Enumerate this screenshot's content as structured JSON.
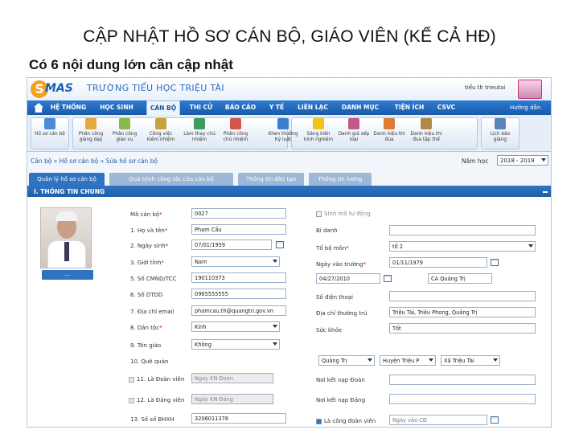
{
  "slide": {
    "title": "CẬP NHẬT HỒ SƠ CÁN BỘ, GIÁO VIÊN (KỂ CẢ HĐ)",
    "subtitle": "Có 6 nội dung lớn cần cập nhật"
  },
  "header": {
    "logo_letter": "S",
    "logo_text": "MAS",
    "school_name": "TRƯỜNG TIỂU HỌC TRIỆU TÀI",
    "user": "tiểu th trieutai"
  },
  "nav": {
    "items": [
      {
        "label": "HỆ THỐNG"
      },
      {
        "label": "HỌC SINH"
      },
      {
        "label": "CÁN BỘ"
      },
      {
        "label": "THI CỬ"
      },
      {
        "label": "BÁO CÁO"
      },
      {
        "label": "Y TẾ"
      },
      {
        "label": "LIÊN LẠC"
      },
      {
        "label": "DANH MỤC"
      },
      {
        "label": "TIỆN ÍCH"
      },
      {
        "label": "CSVC"
      }
    ],
    "help": "Hướng dẫn"
  },
  "toolbar": {
    "buttons": [
      {
        "label": "Hồ sơ cán bộ",
        "icon": "profile-icon",
        "color": "#4b8bd6"
      },
      {
        "label": "Phân công\ngiảng dạy",
        "icon": "teaching-assign-icon",
        "color": "#e5a93b"
      },
      {
        "label": "Phân công\ngiáo vụ",
        "icon": "academic-assign-icon",
        "color": "#8bb84a"
      },
      {
        "label": "Công việc\nkiêm nhiệm",
        "icon": "concurrent-work-icon",
        "color": "#c9a13c"
      },
      {
        "label": "Làm thay chủ\nnhiệm",
        "icon": "substitute-icon",
        "color": "#3f9a5e"
      },
      {
        "label": "Phân công\nchủ nhiệm",
        "icon": "homeroom-assign-icon",
        "color": "#d5554b"
      },
      {
        "label": "Khen thưởng\nKỷ luật",
        "icon": "reward-icon",
        "color": "#3d7fcf"
      },
      {
        "label": "Sáng kiến\nkinh nghiệm",
        "icon": "lightbulb-icon",
        "color": "#f0c419"
      },
      {
        "label": "Danh giá xếp\nloại",
        "icon": "evaluation-icon",
        "color": "#c05a8a"
      },
      {
        "label": "Danh hiệu thi\nđua",
        "icon": "award-icon",
        "color": "#e07b34"
      },
      {
        "label": "Danh hiệu thi\nđua tập thể",
        "icon": "group-award-icon",
        "color": "#b0884a"
      },
      {
        "label": "Lịch báo\ngiảng",
        "icon": "calendar-icon",
        "color": "#5a85b8"
      }
    ]
  },
  "breadcrumb": {
    "text": "Cán bộ » Hồ sơ cán bộ » Sửa hồ sơ cán bộ",
    "year_label": "Năm học",
    "year_value": "2018 - 2019"
  },
  "tabs": [
    {
      "label": "Quản lý hồ sơ cán bộ"
    },
    {
      "label": "Quá trình công tác của cán bộ"
    },
    {
      "label": "Thông tin đào tạo"
    },
    {
      "label": "Thông tin lương"
    }
  ],
  "panel": {
    "title": "I. THÔNG TIN CHUNG",
    "photo_button": "..."
  },
  "form": {
    "left": [
      {
        "label": "Mã cán bộ",
        "req": "*",
        "value": "0027",
        "kind": "input"
      },
      {
        "label": "1. Họ và tên",
        "req": "*",
        "value": "Phạm Cẩu",
        "kind": "input"
      },
      {
        "label": "2. Ngày sinh",
        "req": "*",
        "value": "07/01/1959",
        "kind": "date"
      },
      {
        "label": "3. Giới tính",
        "req": "*",
        "value": "Nam",
        "kind": "select"
      },
      {
        "label": "5. Số CMND/TCC",
        "req": "",
        "value": "190110373",
        "kind": "input"
      },
      {
        "label": "6. Số DTDD",
        "req": "",
        "value": "0965555555",
        "kind": "input"
      },
      {
        "label": "7. Địa chỉ email",
        "req": "",
        "value": "phamcau.th@quangtri.gov.vn",
        "kind": "input"
      },
      {
        "label": "8. Dân tộc",
        "req": "*",
        "value": "Kinh",
        "kind": "select"
      },
      {
        "label": "9. Tôn giáo",
        "req": "",
        "value": "Không",
        "kind": "select"
      },
      {
        "label": "10. Quê quán",
        "req": "",
        "value": "",
        "kind": "none"
      },
      {
        "label": "11. Là Đoàn viên",
        "req": "",
        "value": "Ngày KN Đoàn",
        "kind": "disabled",
        "check": true
      },
      {
        "label": "12. Là Đảng viên",
        "req": "",
        "value": "Ngày KN Đảng",
        "kind": "disabled",
        "check": true
      },
      {
        "label": "13. Số sổ BHXH",
        "req": "",
        "value": "3206011378",
        "kind": "input"
      }
    ],
    "right": {
      "living_label": "Sinh mã tự động",
      "alias_label": "Bí danh",
      "dept_label": "Tổ bộ môn",
      "dept_req": "*",
      "dept_value": "tổ 2",
      "join_label": "Ngày vào trường",
      "join_req": "*",
      "join_value": "01/11/1979",
      "issue_date": "04/27/2010",
      "issue_place": "CA Quảng Trị",
      "phone_label": "Số điện thoại",
      "addr_label": "Địa chỉ thường trú",
      "addr_value": "Triệu Tài, Triệu Phong, Quảng Trị",
      "health_label": "Sức khỏe",
      "health_value": "Tốt",
      "province": "Quảng Trị",
      "district": "Huyện Triệu P",
      "commune": "Xã Triệu Tài",
      "youth_place_label": "Nơi kết nạp Đoàn",
      "party_place_label": "Nơi kết nạp Đảng",
      "union_label": "Là công đoàn viên",
      "union_date_placeholder": "Ngày vào CĐ"
    }
  },
  "colors": {
    "nav_blue": "#1a5aa8",
    "accent": "#2f73c2",
    "required": "#dd0000"
  }
}
